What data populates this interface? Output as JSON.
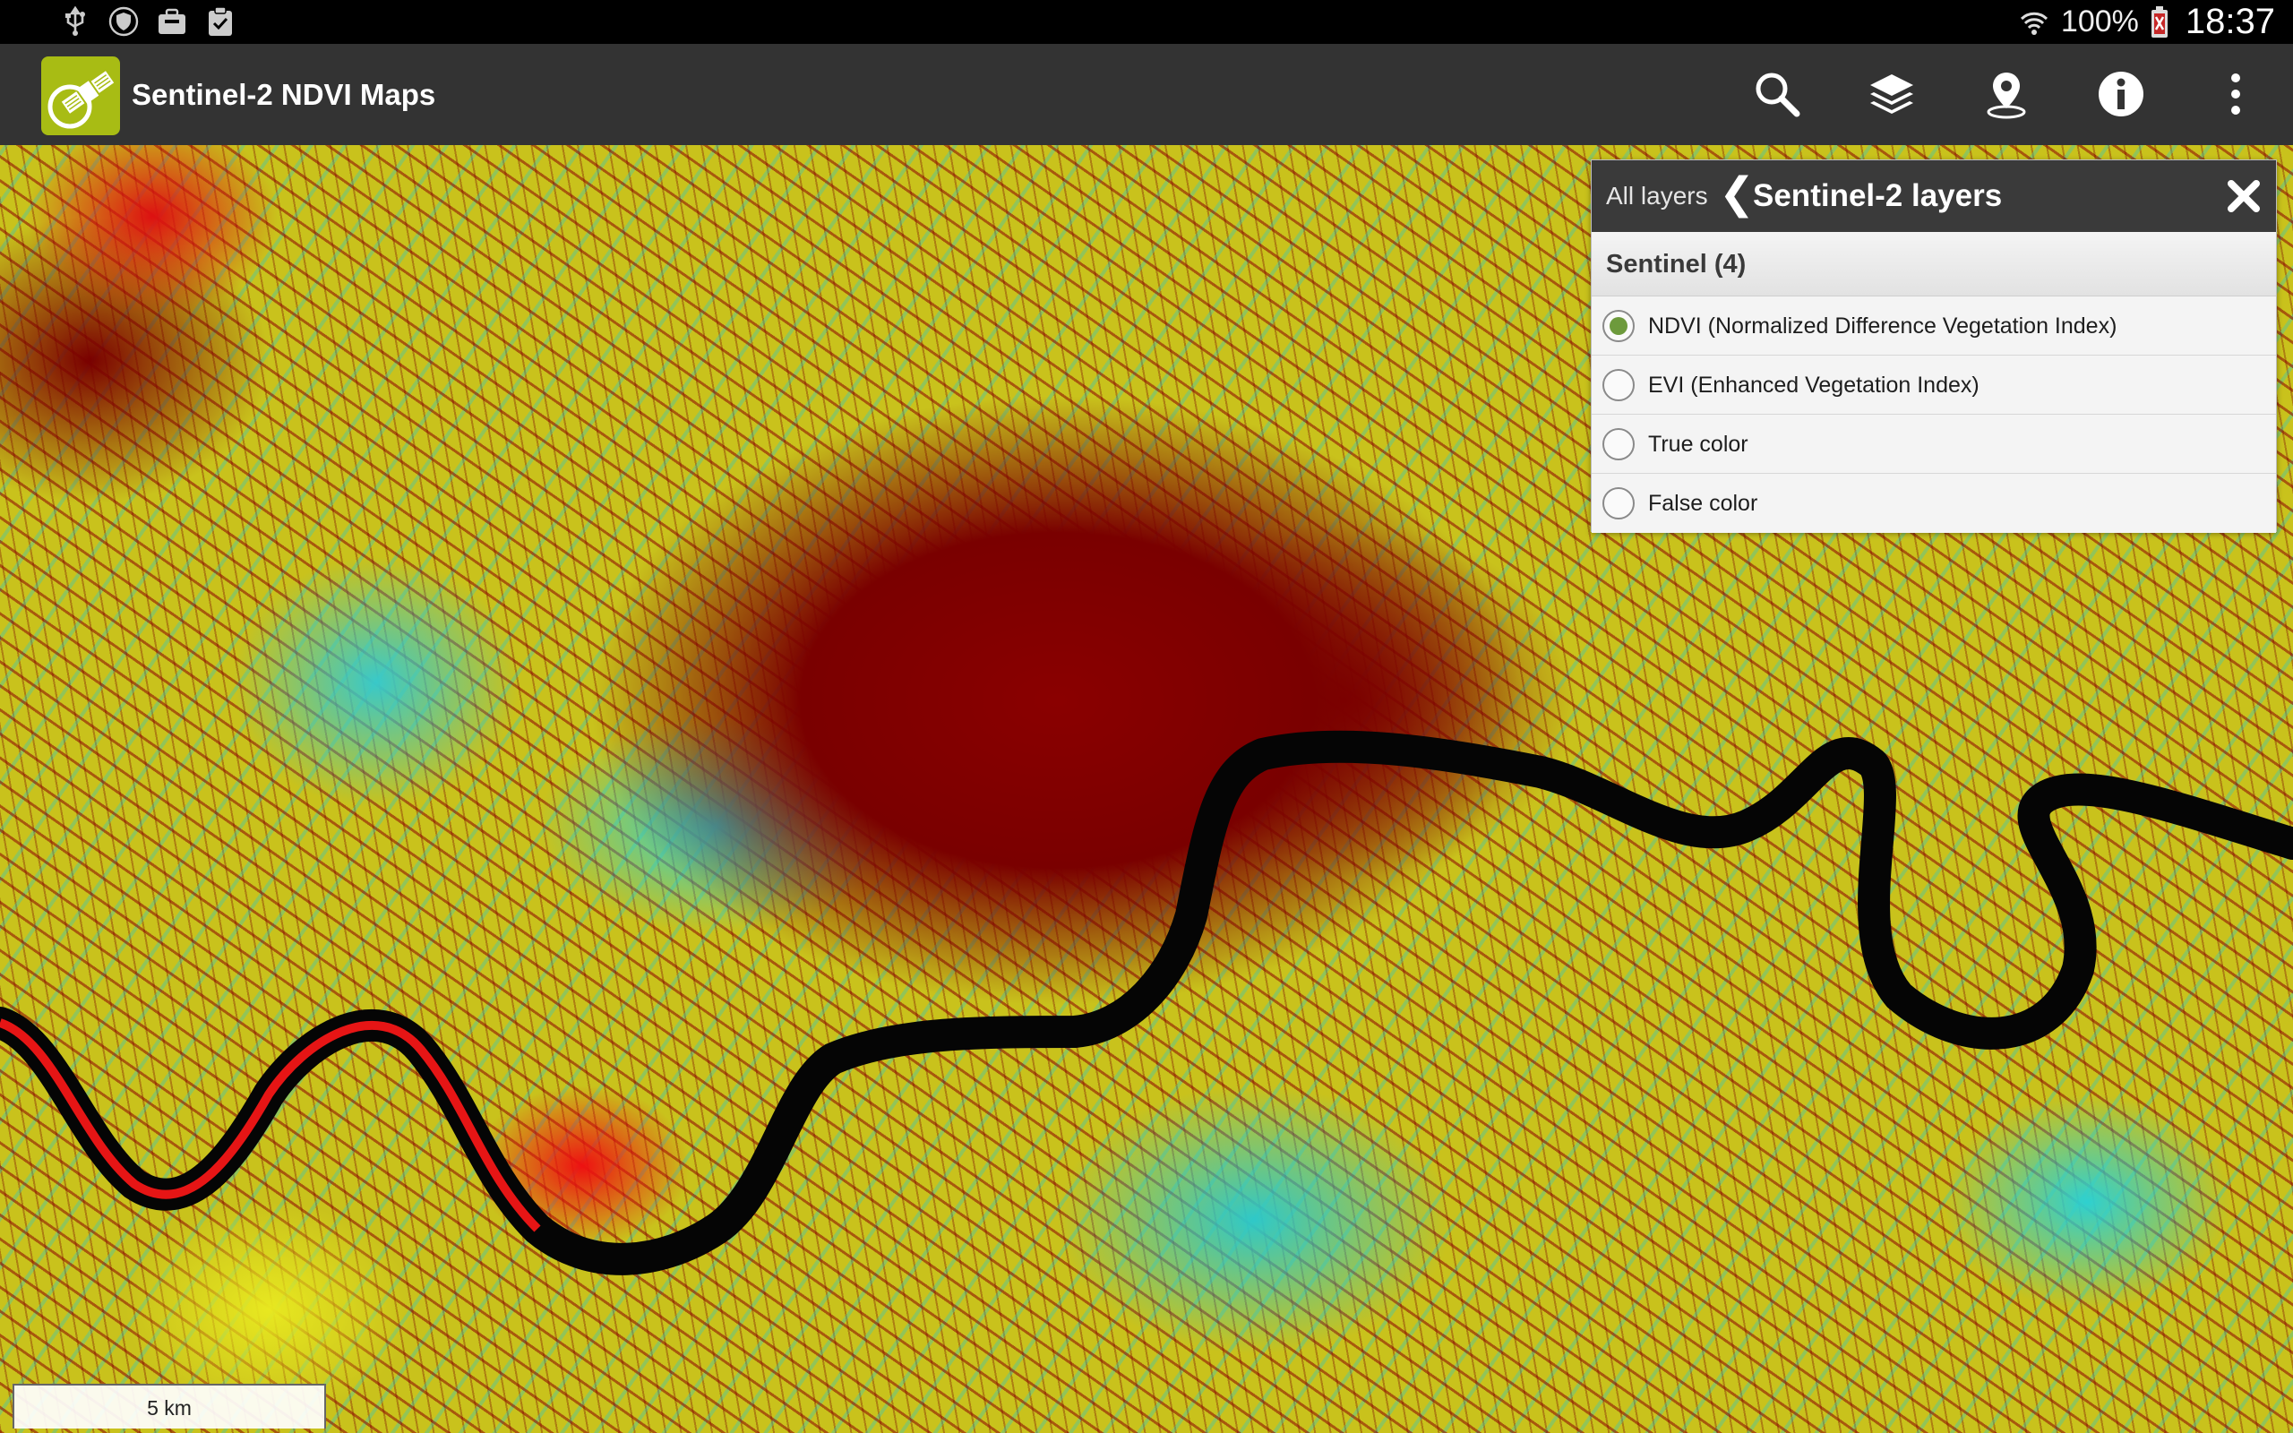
{
  "status_bar": {
    "left_icons": [
      "usb-icon",
      "shield-icon",
      "briefcase-icon",
      "clipboard-check-icon"
    ],
    "battery_percent": "100%",
    "time": "18:37",
    "right_icons": [
      "wifi-icon",
      "battery-icon"
    ]
  },
  "action_bar": {
    "app_title": "Sentinel-2 NDVI Maps",
    "app_icon": "satellite-logo-icon",
    "actions": [
      "search-icon",
      "layers-icon",
      "location-pin-icon",
      "info-icon",
      "overflow-menu-icon"
    ],
    "background_color": "#333333",
    "logo_color": "#a8bc14"
  },
  "layers_panel": {
    "back_label": "All layers",
    "back_chevron": "❮",
    "title": "Sentinel-2 layers",
    "group_label": "Sentinel (4)",
    "items": [
      {
        "label": "NDVI (Normalized Difference Vegetation Index)",
        "checked": true
      },
      {
        "label": "EVI (Enhanced Vegetation Index)",
        "checked": false
      },
      {
        "label": "True color",
        "checked": false
      },
      {
        "label": "False color",
        "checked": false
      }
    ],
    "selected_color": "#6d9a3c"
  },
  "map": {
    "scale_label": "5 km",
    "palette": [
      "#000000",
      "#7a0000",
      "#ee1111",
      "#e8e820",
      "#2ed0d0",
      "#22dd22"
    ]
  }
}
